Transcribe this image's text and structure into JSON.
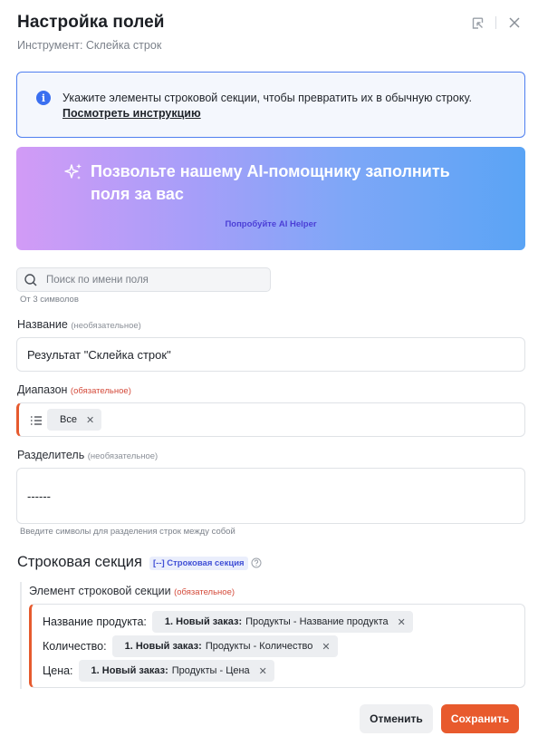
{
  "header": {
    "title": "Настройка полей",
    "subtitle": "Инструмент: Склейка строк"
  },
  "info": {
    "text": "Укажите элементы строковой секции, чтобы превратить их в обычную строку.",
    "link": "Посмотреть инструкцию"
  },
  "ai_banner": {
    "title": "Позвольте нашему AI-помощнику заполнить поля за вас",
    "link": "Попробуйте AI Helper"
  },
  "search": {
    "placeholder": "Поиск по имени поля",
    "hint": "От 3 символов"
  },
  "name_field": {
    "label": "Название",
    "tag": "(необязательное)",
    "value": "Результат \"Склейка строк\""
  },
  "range_field": {
    "label": "Диапазон",
    "tag": "(обязательное)",
    "chip": "Все"
  },
  "separator_field": {
    "label": "Разделитель",
    "tag": "(необязательное)",
    "value": "------",
    "hint": "Введите символы для разделения строк между собой"
  },
  "row_section": {
    "title": "Строковая секция",
    "badge": "[--] Строковая секция",
    "element_label": "Элемент строковой секции",
    "element_tag": "(обязательное)",
    "rows": [
      {
        "label": "Название продукта:",
        "chip_bold": "1. Новый заказ:",
        "chip_text": "Продукты - Название продукта"
      },
      {
        "label": "Количество:",
        "chip_bold": "1. Новый заказ:",
        "chip_text": "Продукты - Количество"
      },
      {
        "label": "Цена:",
        "chip_bold": "1. Новый заказ:",
        "chip_text": "Продукты - Цена"
      }
    ]
  },
  "footer": {
    "cancel": "Отменить",
    "save": "Сохранить"
  },
  "colors": {
    "accent": "#e85a2d",
    "info_border": "#4f7ff0",
    "badge": "#4150d6"
  }
}
